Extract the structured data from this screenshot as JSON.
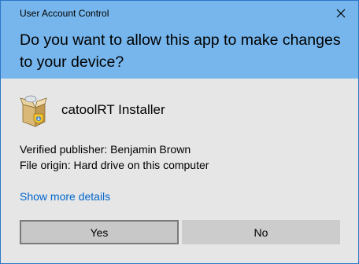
{
  "window": {
    "title": "User Account Control",
    "close_icon": "close-icon",
    "header_color": "#77b6ec",
    "border_color": "#2b78c8"
  },
  "prompt": {
    "question": "Do you want to allow this app to make changes to your device?"
  },
  "app": {
    "icon": "installer-box-icon",
    "name": "catoolRT Installer",
    "publisher": "Verified publisher: Benjamin Brown",
    "origin": "File origin: Hard drive on this computer"
  },
  "links": {
    "details": "Show more details",
    "link_color": "#0066cc"
  },
  "buttons": {
    "yes": "Yes",
    "no": "No"
  }
}
